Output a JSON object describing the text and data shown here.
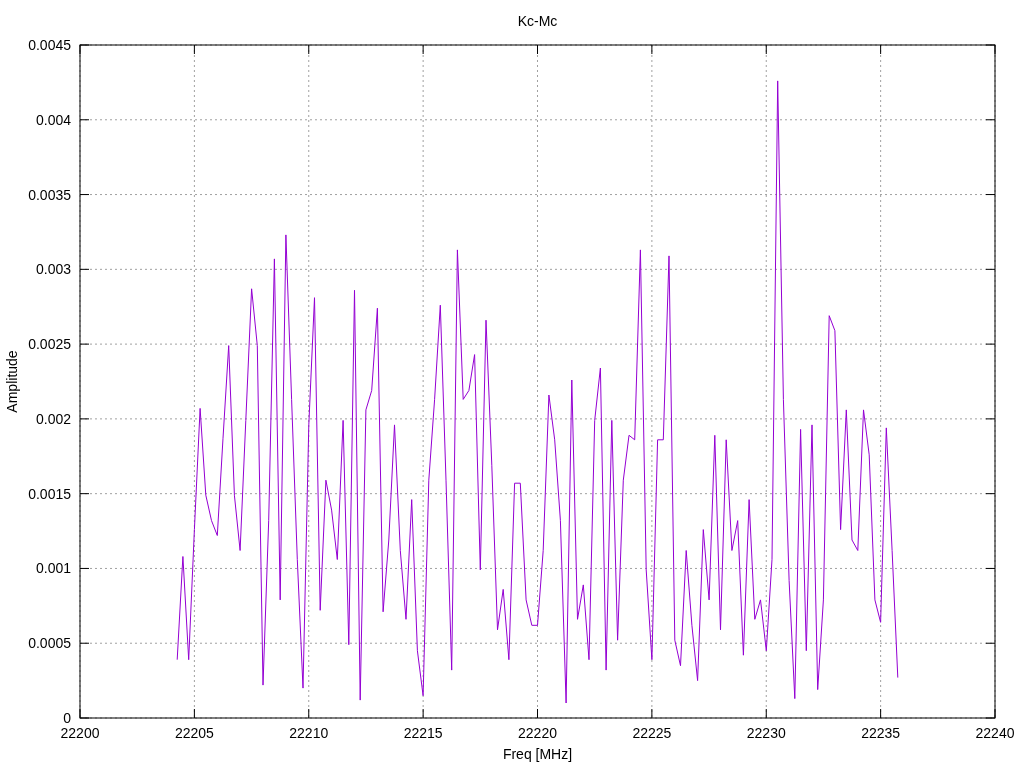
{
  "plot": {
    "chart_data": {
      "type": "line",
      "title": "Kc-Mc",
      "xlabel": "Freq [MHz]",
      "ylabel": "Amplitude",
      "xlim": [
        22200,
        22240
      ],
      "ylim": [
        0,
        0.0045
      ],
      "xticks": [
        22200,
        22205,
        22210,
        22215,
        22220,
        22225,
        22230,
        22235,
        22240
      ],
      "yticks": [
        0,
        0.0005,
        0.001,
        0.0015,
        0.002,
        0.0025,
        0.003,
        0.0035,
        0.004,
        0.0045
      ],
      "x": [
        22204.25,
        22204.5,
        22204.75,
        22205,
        22205.25,
        22205.5,
        22205.75,
        22206,
        22206.25,
        22206.5,
        22206.75,
        22207,
        22207.25,
        22207.5,
        22207.75,
        22208,
        22208.25,
        22208.5,
        22208.75,
        22209,
        22209.25,
        22209.5,
        22209.75,
        22210,
        22210.25,
        22210.5,
        22210.75,
        22211,
        22211.25,
        22211.5,
        22211.75,
        22212,
        22212.25,
        22212.5,
        22212.75,
        22213,
        22213.25,
        22213.5,
        22213.75,
        22214,
        22214.25,
        22214.5,
        22214.75,
        22215,
        22215.25,
        22215.5,
        22215.75,
        22216,
        22216.25,
        22216.5,
        22216.75,
        22217,
        22217.25,
        22217.5,
        22217.75,
        22218,
        22218.25,
        22218.5,
        22218.75,
        22219,
        22219.25,
        22219.5,
        22219.75,
        22220,
        22220.25,
        22220.5,
        22220.75,
        22221,
        22221.25,
        22221.5,
        22221.75,
        22222,
        22222.25,
        22222.5,
        22222.75,
        22223,
        22223.25,
        22223.5,
        22223.75,
        22224,
        22224.25,
        22224.5,
        22224.75,
        22225,
        22225.25,
        22225.5,
        22225.75,
        22226,
        22226.25,
        22226.5,
        22226.75,
        22227,
        22227.25,
        22227.5,
        22227.75,
        22228,
        22228.25,
        22228.5,
        22228.75,
        22229,
        22229.25,
        22229.5,
        22229.75,
        22230,
        22230.25,
        22230.5,
        22230.75,
        22231,
        22231.25,
        22231.5,
        22231.75,
        22232,
        22232.25,
        22232.5,
        22232.75,
        22233,
        22233.25,
        22233.5,
        22233.75,
        22234,
        22234.25,
        22234.5,
        22234.75,
        22235,
        22235.25,
        22235.5,
        22235.75
      ],
      "grid": true,
      "series": [
        {
          "color": "#9400d3",
          "values": [
            0.00039,
            0.00108,
            0.00039,
            0.00126,
            0.00207,
            0.00149,
            0.00132,
            0.00122,
            0.00187,
            0.00249,
            0.00149,
            0.00112,
            0.00199,
            0.00287,
            0.00249,
            0.00022,
            0.00132,
            0.00307,
            0.00079,
            0.00323,
            0.00213,
            0.00106,
            0.0002,
            0.00196,
            0.00281,
            0.00072,
            0.00159,
            0.00139,
            0.00106,
            0.00199,
            0.00049,
            0.00286,
            0.00012,
            0.00206,
            0.00219,
            0.00274,
            0.00071,
            0.00119,
            0.00196,
            0.00112,
            0.00066,
            0.00146,
            0.00045,
            0.00015,
            0.00159,
            0.00213,
            0.00276,
            0.00159,
            0.00032,
            0.00313,
            0.00213,
            0.00219,
            0.00243,
            0.00099,
            0.00266,
            0.00169,
            0.00059,
            0.00086,
            0.00039,
            0.00157,
            0.00157,
            0.00079,
            0.00062,
            0.00062,
            0.00112,
            0.00216,
            0.00186,
            0.00132,
            0.0001,
            0.00226,
            0.00066,
            0.00089,
            0.00039,
            0.00199,
            0.00234,
            0.00032,
            0.00199,
            0.00052,
            0.00159,
            0.00189,
            0.00186,
            0.00313,
            0.00099,
            0.00039,
            0.00186,
            0.00186,
            0.00309,
            0.00052,
            0.00035,
            0.00112,
            0.00062,
            0.00025,
            0.00126,
            0.00079,
            0.00189,
            0.00059,
            0.00186,
            0.00112,
            0.00132,
            0.00042,
            0.00146,
            0.00066,
            0.00079,
            0.00045,
            0.00106,
            0.00426,
            0.00213,
            0.00092,
            0.00013,
            0.00193,
            0.00045,
            0.00196,
            0.00019,
            0.00079,
            0.00269,
            0.00259,
            0.00126,
            0.00206,
            0.00119,
            0.00112,
            0.00206,
            0.00176,
            0.00079,
            0.00064,
            0.00194,
            0.00112,
            0.00027
          ]
        }
      ]
    }
  }
}
